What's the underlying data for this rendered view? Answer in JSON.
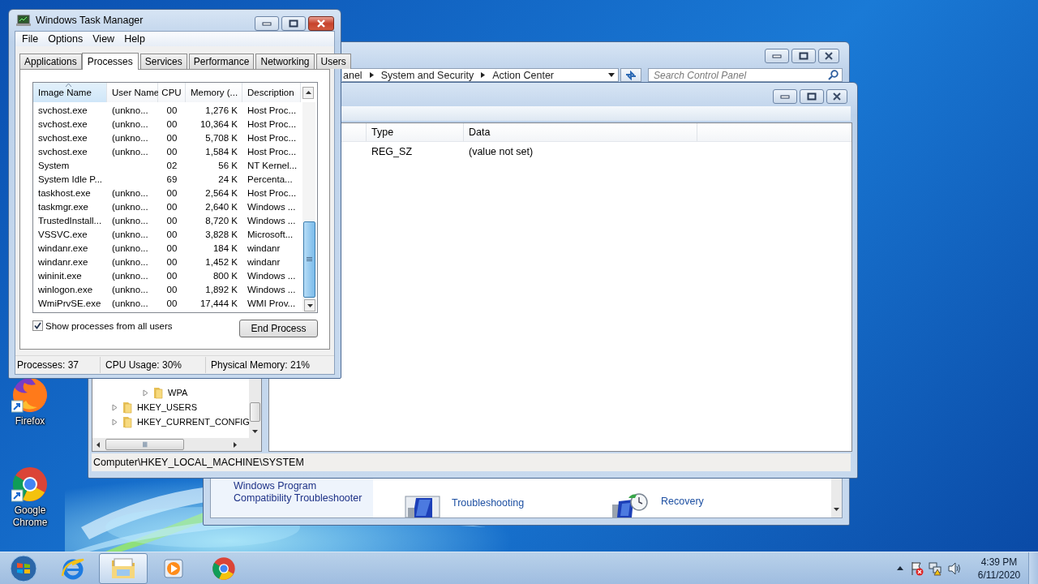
{
  "desktop_icons": [
    {
      "kind": "firefox",
      "label": "Firefox"
    },
    {
      "kind": "chrome",
      "label": "Google Chrome"
    }
  ],
  "control_panel": {
    "breadcrumb": [
      "anel",
      "System and Security",
      "Action Center"
    ],
    "search": {
      "placeholder": "Search Control Panel"
    },
    "sidebar_link": "Windows Program Compatibility Troubleshooter",
    "items": [
      {
        "kind": "troubleshooting",
        "label": "Troubleshooting"
      },
      {
        "kind": "recovery",
        "label": "Recovery"
      }
    ]
  },
  "registry_editor": {
    "tree": [
      {
        "children": [
          {
            "label": "WPA",
            "expanded": false
          }
        ]
      },
      {
        "label": "HKEY_USERS",
        "expanded": false
      },
      {
        "label": "HKEY_CURRENT_CONFIG",
        "expanded": false
      }
    ],
    "columns": [
      "Type",
      "Data"
    ],
    "rows": [
      {
        "type": "REG_SZ",
        "data": "(value not set)"
      }
    ],
    "status_bar": "Computer\\HKEY_LOCAL_MACHINE\\SYSTEM"
  },
  "task_manager": {
    "title": "Windows Task Manager",
    "menu": [
      "File",
      "Options",
      "View",
      "Help"
    ],
    "tabs": [
      {
        "label": "Applications",
        "selected": false
      },
      {
        "label": "Processes",
        "selected": true
      },
      {
        "label": "Services",
        "selected": false
      },
      {
        "label": "Performance",
        "selected": false
      },
      {
        "label": "Networking",
        "selected": false
      },
      {
        "label": "Users",
        "selected": false
      }
    ],
    "columns": [
      {
        "label": "Image Name",
        "sorted": true
      },
      {
        "label": "User Name",
        "sorted": false
      },
      {
        "label": "CPU",
        "sorted": false
      },
      {
        "label": "Memory (...",
        "sorted": false
      },
      {
        "label": "Description",
        "sorted": false
      }
    ],
    "rows": [
      {
        "image_name": "svchost.exe",
        "user_name": "(unkno...",
        "cpu": "00",
        "memory": "1,276 K",
        "description": "Host Proc..."
      },
      {
        "image_name": "svchost.exe",
        "user_name": "(unkno...",
        "cpu": "00",
        "memory": "10,364 K",
        "description": "Host Proc..."
      },
      {
        "image_name": "svchost.exe",
        "user_name": "(unkno...",
        "cpu": "00",
        "memory": "5,708 K",
        "description": "Host Proc..."
      },
      {
        "image_name": "svchost.exe",
        "user_name": "(unkno...",
        "cpu": "00",
        "memory": "1,584 K",
        "description": "Host Proc..."
      },
      {
        "image_name": "System",
        "cpu": "02",
        "memory": "56 K",
        "description": "NT Kernel..."
      },
      {
        "image_name": "System Idle P...",
        "cpu": "69",
        "memory": "24 K",
        "description": "Percenta..."
      },
      {
        "image_name": "taskhost.exe",
        "user_name": "(unkno...",
        "cpu": "00",
        "memory": "2,564 K",
        "description": "Host Proc..."
      },
      {
        "image_name": "taskmgr.exe",
        "user_name": "(unkno...",
        "cpu": "00",
        "memory": "2,640 K",
        "description": "Windows ..."
      },
      {
        "image_name": "TrustedInstall...",
        "user_name": "(unkno...",
        "cpu": "00",
        "memory": "8,720 K",
        "description": "Windows ..."
      },
      {
        "image_name": "VSSVC.exe",
        "user_name": "(unkno...",
        "cpu": "00",
        "memory": "3,828 K",
        "description": "Microsoft..."
      },
      {
        "image_name": "windanr.exe",
        "user_name": "(unkno...",
        "cpu": "00",
        "memory": "184 K",
        "description": "windanr"
      },
      {
        "image_name": "windanr.exe",
        "user_name": "(unkno...",
        "cpu": "00",
        "memory": "1,452 K",
        "description": "windanr"
      },
      {
        "image_name": "wininit.exe",
        "user_name": "(unkno...",
        "cpu": "00",
        "memory": "800 K",
        "description": "Windows ..."
      },
      {
        "image_name": "winlogon.exe",
        "user_name": "(unkno...",
        "cpu": "00",
        "memory": "1,892 K",
        "description": "Windows ..."
      },
      {
        "image_name": "WmiPrvSE.exe",
        "user_name": "(unkno...",
        "cpu": "00",
        "memory": "17,444 K",
        "description": "WMI Prov..."
      }
    ],
    "show_all_users": {
      "label": "Show processes from all users",
      "checked": true
    },
    "end_button": "End Process",
    "status_bar": [
      "Processes: 37",
      "CPU Usage: 30%",
      "Physical Memory: 21%"
    ]
  },
  "taskbar": {
    "apps": [
      {
        "kind": "ie",
        "selected": false
      },
      {
        "kind": "explorer",
        "selected": true
      },
      {
        "kind": "media",
        "selected": false
      },
      {
        "kind": "chrome",
        "selected": false
      }
    ],
    "clock": {
      "time": "4:39 PM",
      "date": "6/11/2020"
    }
  }
}
